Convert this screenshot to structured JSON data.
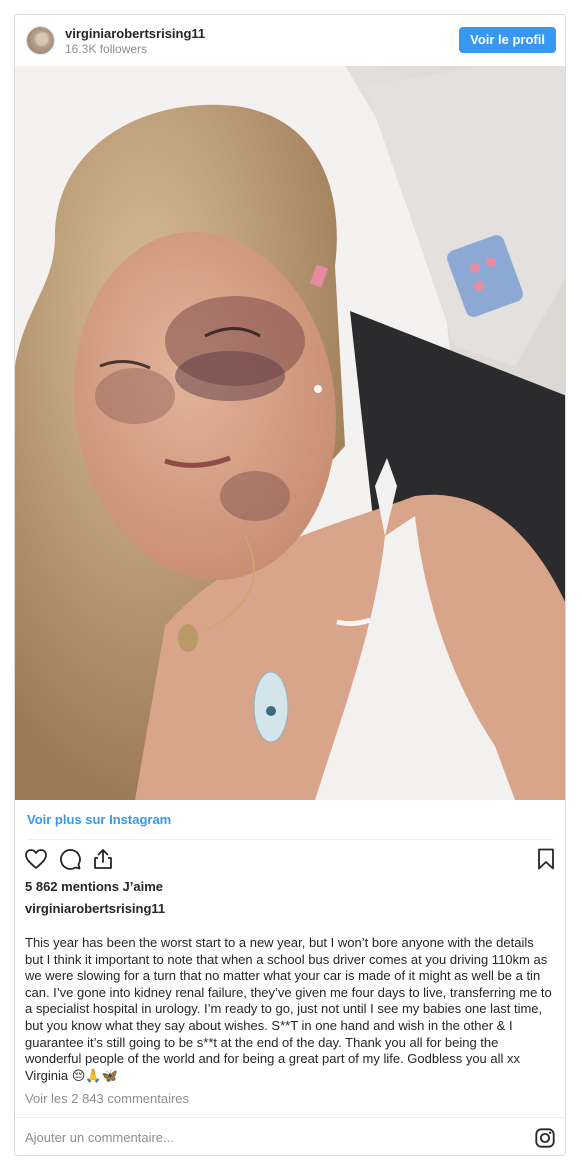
{
  "header": {
    "username": "virginiarobertsrising11",
    "followers": "16.3K followers",
    "profile_button": "Voir le profil"
  },
  "photo": {
    "alt": "photo"
  },
  "more_link": "Voir plus sur Instagram",
  "actions": {
    "icons": [
      "heart-icon",
      "comment-icon",
      "share-icon",
      "bookmark-icon"
    ]
  },
  "likes": "5 862 mentions J’aime",
  "caption_user": "virginiarobertsrising11",
  "caption": "This year has been the worst start to a new year, but I won’t bore anyone with the details but I think it important to note that when a school bus driver comes at you driving 110km as we were slowing for a turn that no matter what your car is made of it might as well be a tin can. I’ve gone into kidney renal failure, they’ve given me four days to live, transferring me to a specialist hospital in urology. I’m ready to go, just not until I see my babies one last time, but you know what they say about wishes. S**T in one hand and wish in the other & I guarantee it’s still going to be s**t at the end of the day. Thank you all for being the wonderful people of the world and for being a great part of my life. Godbless you all xx Virginia 😔🙏🦋",
  "comments_link": "Voir les 2 843 commentaires",
  "comment_placeholder": "Ajouter un commentaire...",
  "colors": {
    "accent": "#3897f0",
    "text": "#262626",
    "muted": "#8e8e8e",
    "border": "#dbdbdb"
  }
}
